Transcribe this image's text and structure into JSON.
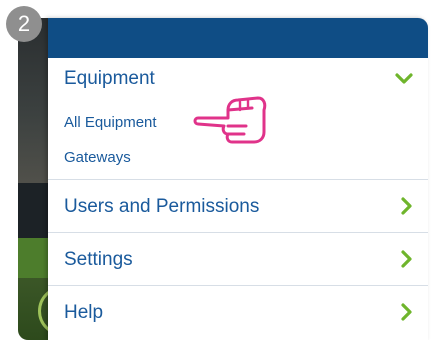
{
  "step": {
    "number": "2"
  },
  "menu": {
    "equipment": {
      "title": "Equipment",
      "items": [
        "All Equipment",
        "Gateways"
      ]
    },
    "rows": [
      {
        "label": "Users and Permissions"
      },
      {
        "label": "Settings"
      },
      {
        "label": "Help"
      }
    ]
  },
  "colors": {
    "header": "#0f4d85",
    "link": "#1a5a9c",
    "chevron": "#6fb52c",
    "pointer": "#e0338a",
    "badge": "#8f8f8f"
  },
  "icons": {
    "expanded": "chevron-down-icon",
    "collapsed": "chevron-right-icon",
    "pointer": "pointing-hand-icon"
  }
}
